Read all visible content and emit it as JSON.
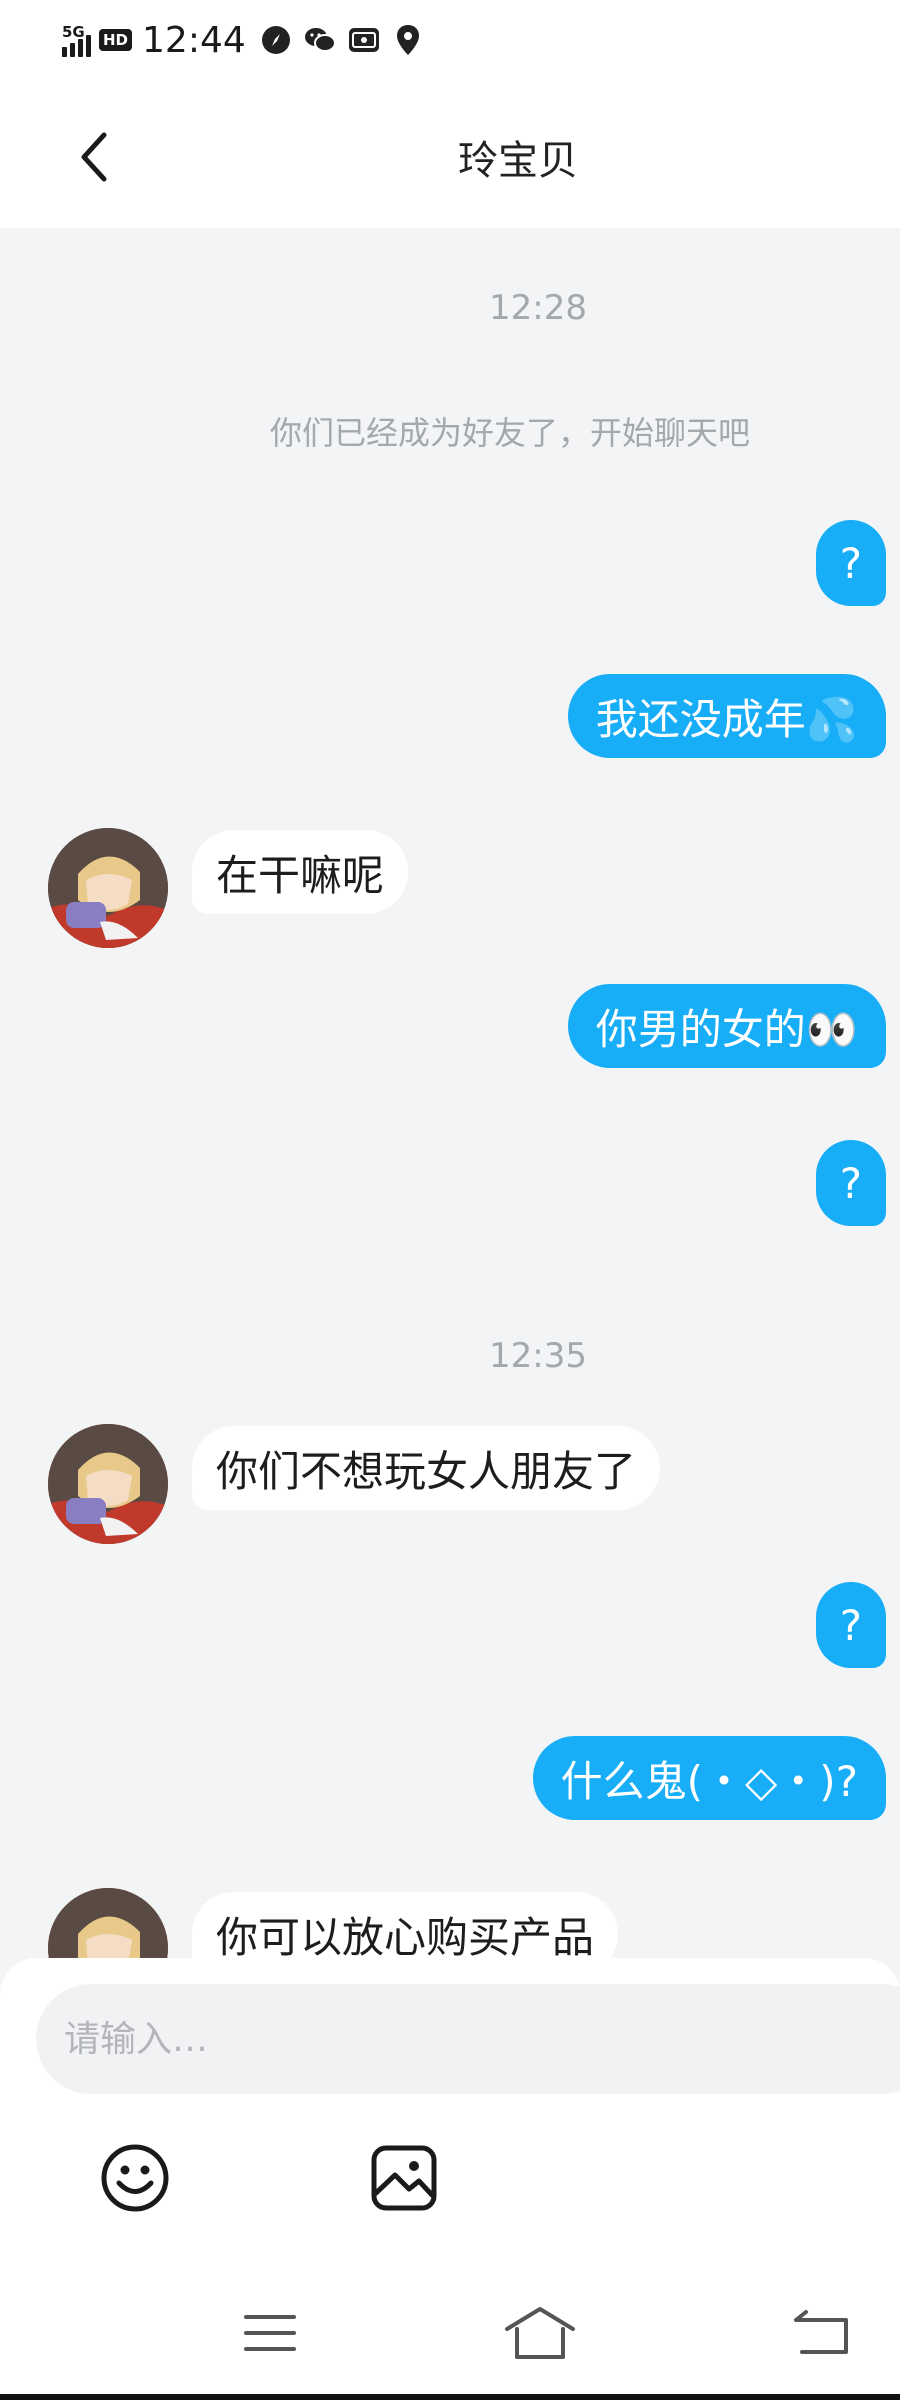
{
  "status_bar": {
    "network": "5G",
    "hd": "HD",
    "time": "12:44",
    "icons": [
      "compass-icon",
      "wechat-icon",
      "gallery-icon",
      "map-pin-icon"
    ]
  },
  "header": {
    "title": "玲宝贝",
    "back_icon": "chevron-left-icon"
  },
  "messages": [
    {
      "kind": "time",
      "text": "12:28"
    },
    {
      "kind": "notice",
      "text": "你们已经成为好友了，开始聊天吧"
    },
    {
      "kind": "sent",
      "text": "?"
    },
    {
      "kind": "sent",
      "text": "我还没成年💦"
    },
    {
      "kind": "received",
      "text": "在干嘛呢"
    },
    {
      "kind": "sent",
      "text": "你男的女的👀"
    },
    {
      "kind": "sent",
      "text": "?"
    },
    {
      "kind": "time",
      "text": "12:35"
    },
    {
      "kind": "received",
      "text": "你们不想玩女人朋友了"
    },
    {
      "kind": "sent",
      "text": "?"
    },
    {
      "kind": "sent",
      "text": "什么鬼(・◇・)?"
    },
    {
      "kind": "received",
      "text": "你可以放心购买产品"
    }
  ],
  "input": {
    "placeholder": "请输入…",
    "value": ""
  },
  "toolbar": {
    "emoji_icon": "smiley-icon",
    "image_icon": "image-icon"
  },
  "nav": {
    "icons": [
      "menu-icon",
      "home-icon",
      "back-icon"
    ]
  },
  "colors": {
    "sent_bubble": "#17adf7",
    "received_bubble": "#ffffff",
    "chat_background": "#f3f4f6",
    "meta_text": "#a4a7ad"
  }
}
